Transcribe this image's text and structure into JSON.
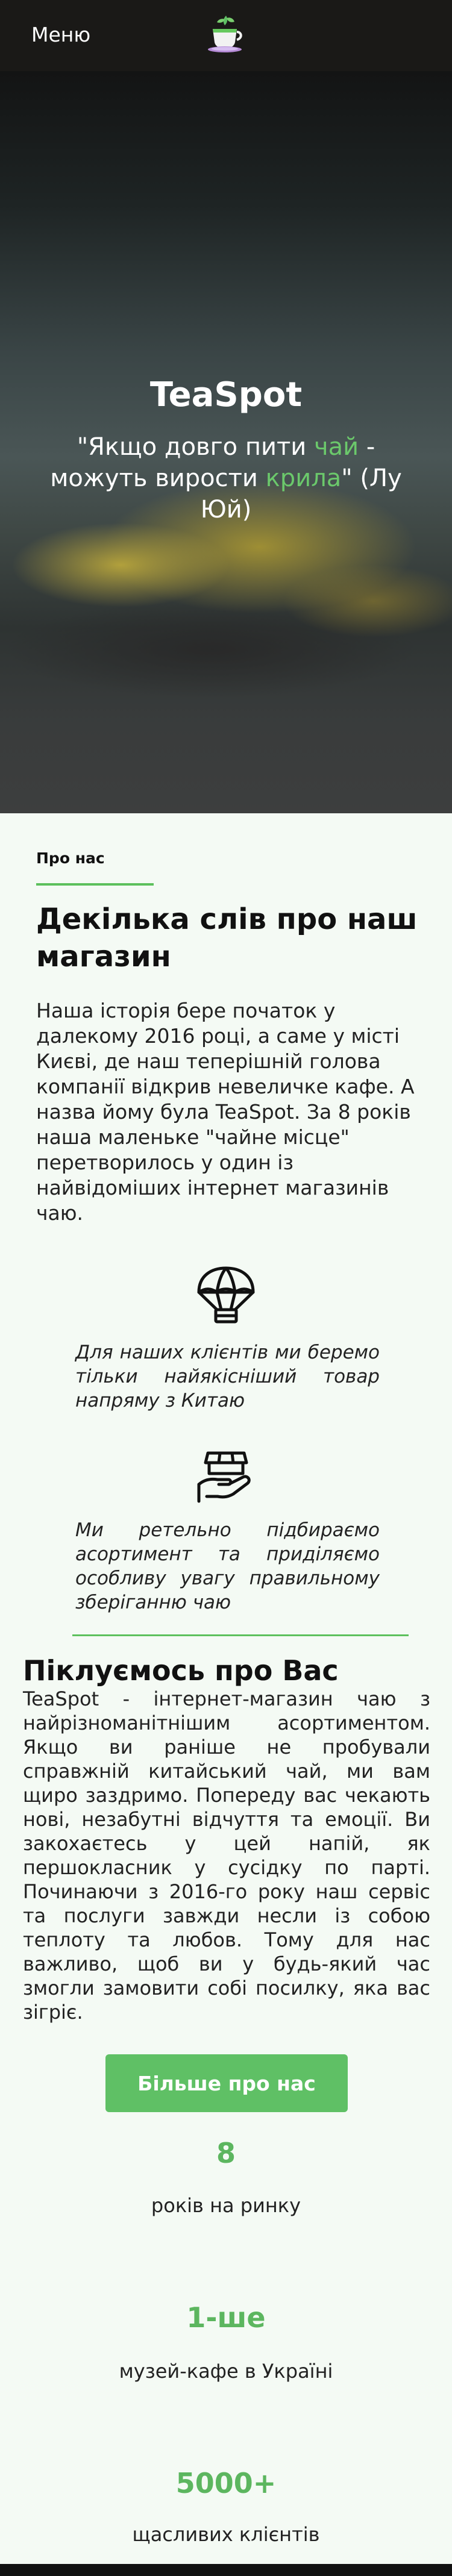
{
  "header": {
    "menu_label": "Меню",
    "logo_icon": "tea-cup-icon"
  },
  "hero": {
    "title": "TeaSpot",
    "quote_part1": "\"Якщо довго пити ",
    "quote_highlight1": "чай",
    "quote_part2": " - можуть вирости ",
    "quote_highlight2": "крила",
    "quote_part3": "\" (Лу Юй)"
  },
  "about": {
    "label": "Про нас",
    "heading": "Декілька слів про наш магазин",
    "text": "Наша історія бере початок у далекому 2016 році, а саме у місті Києві, де наш теперішній голова компанії відкрив невеличке кафе. А назва йому була TeaSpot. За 8 років наша маленьке \"чайне місце\" перетворилось у один із найвідоміших інтернет магазинів чаю."
  },
  "features": [
    {
      "icon": "parachute-icon",
      "text": "Для наших клієнтів ми беремо тільки найякісніший товар напряму з Китаю"
    },
    {
      "icon": "hand-holding-box-icon",
      "text": "Ми ретельно підбираємо асортимент та приділяємо особливу увагу правильному зберіганню чаю"
    }
  ],
  "care": {
    "heading": "Піклуємось про Вас",
    "text": "TeaSpot - інтернет-магазин чаю з найрізноманітнішим асортиментом. Якщо ви раніше не пробували справжній китайський чай, ми вам щиро заздримо. Попереду вас чекають нові, незабутні відчуття та емоції. Ви закохаєтесь у цей напій, як першокласник у сусідку по парті. Починаючи з 2016-го року наш сервіс та послуги завжди несли із собою теплоту та любов. Тому для нас важливо, щоб ви у будь-який час змогли замовити собі посилку, яка вас зігріє.",
    "button_label": "Більше про нас"
  },
  "stats": [
    {
      "value": "8",
      "label": "років на ринку"
    },
    {
      "value": "1-ше",
      "label": "музей-кафе в Україні"
    },
    {
      "value": "5000+",
      "label": "щасливих клієнтів"
    }
  ],
  "colors": {
    "accent": "#5fc065",
    "header_bg": "#1a1917",
    "page_bg": "#f4faf4"
  }
}
